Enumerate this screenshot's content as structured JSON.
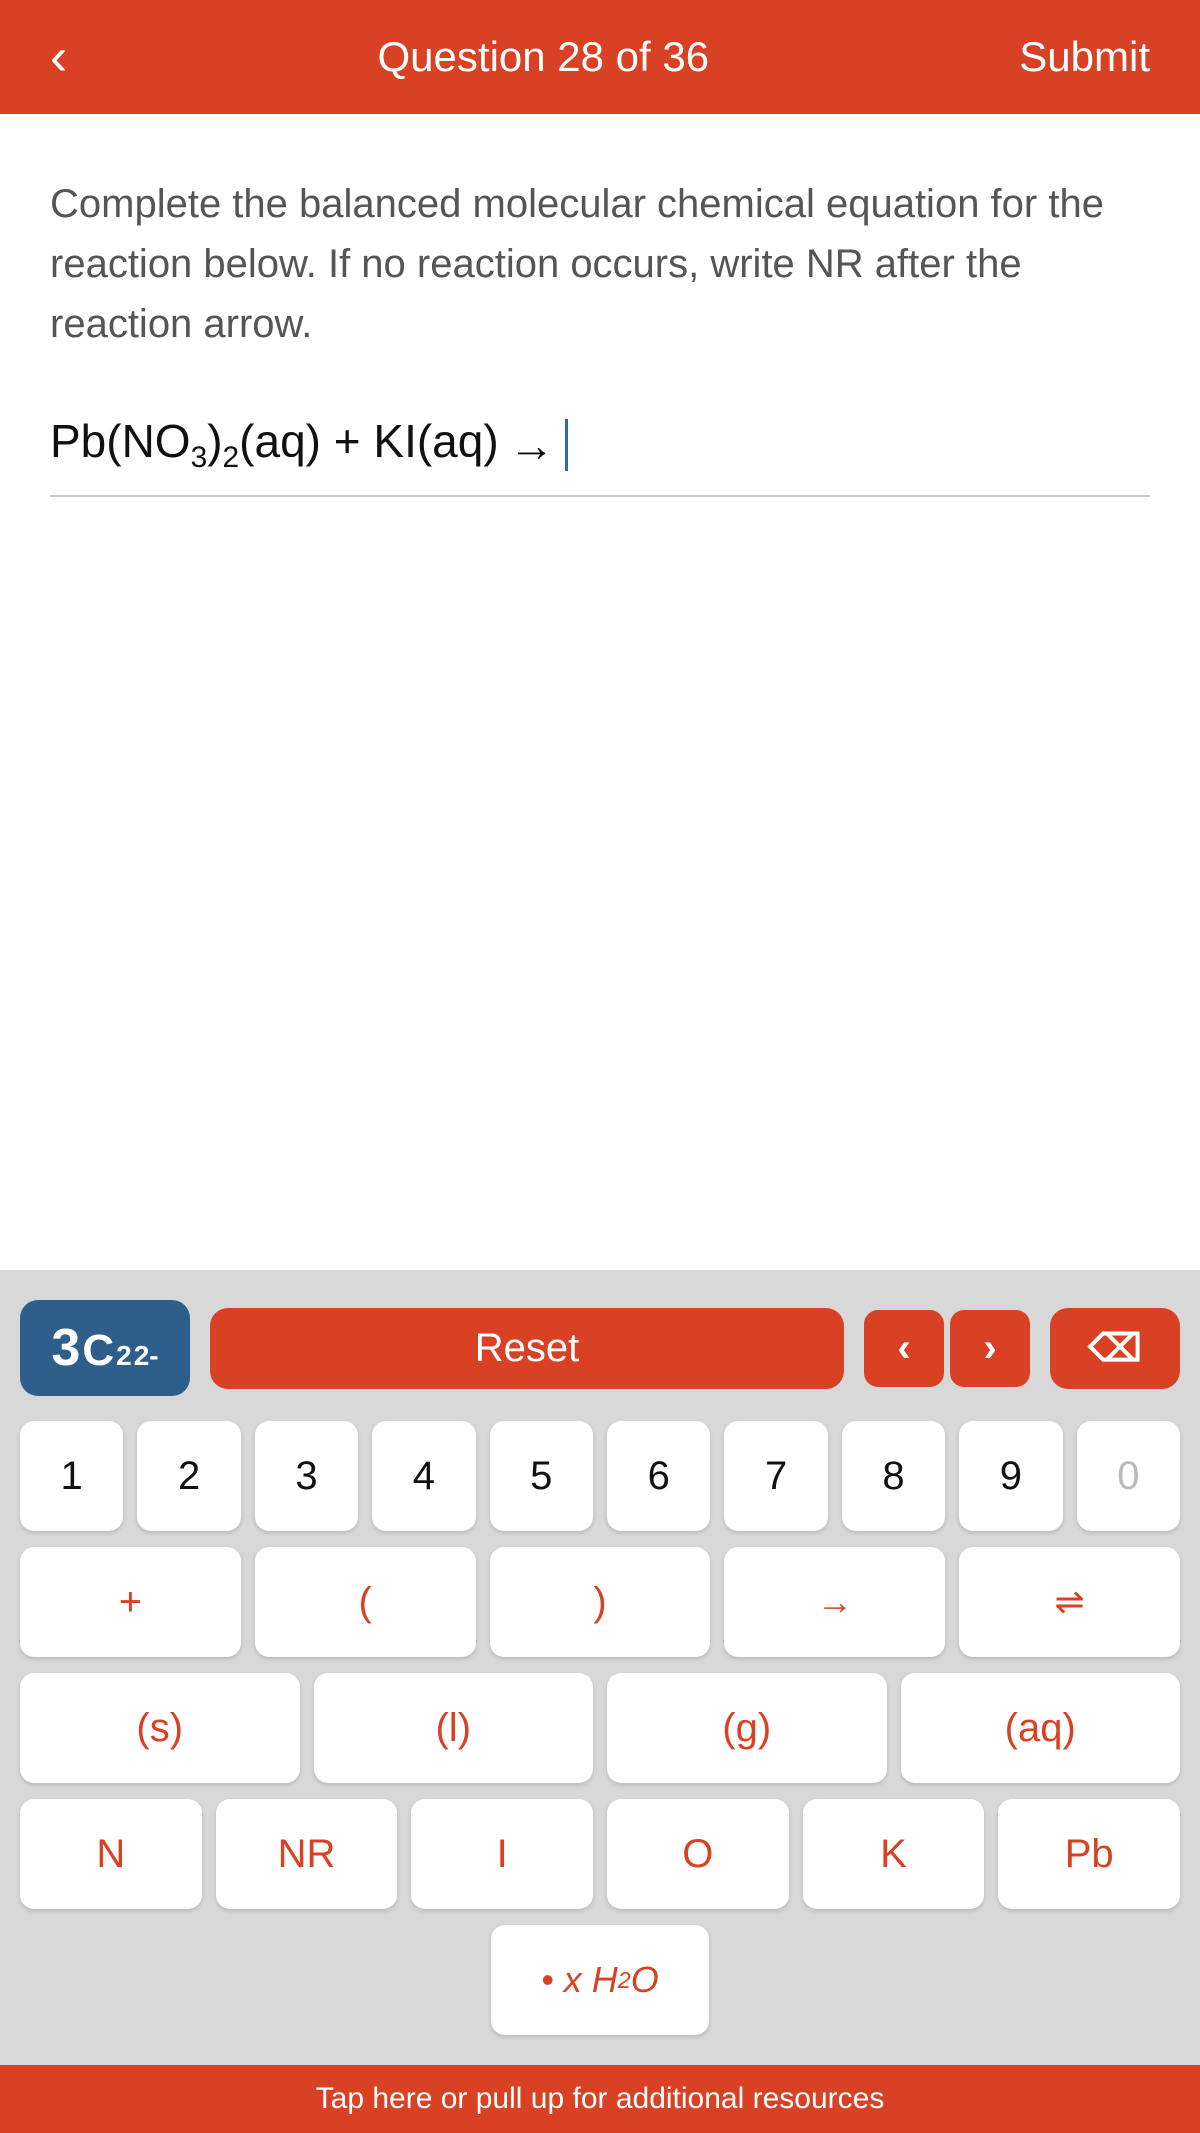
{
  "header": {
    "back_label": "‹",
    "title": "Question 28 of 36",
    "submit_label": "Submit"
  },
  "question": {
    "text": "Complete the balanced molecular chemical equation for the reaction below. If no reaction occurs, write NR after the reaction arrow."
  },
  "equation": {
    "left": "Pb(NO",
    "left_sub1": "3",
    "left_close": ")",
    "left_sub2": "2",
    "left_aq": "(aq) + KI(aq)",
    "arrow": "→"
  },
  "keyboard": {
    "coeff_label": "3C₂²⁻",
    "reset_label": "Reset",
    "nav_left": "‹",
    "nav_right": "›",
    "numbers": [
      "1",
      "2",
      "3",
      "4",
      "5",
      "6",
      "7",
      "8",
      "9",
      "0"
    ],
    "symbols": [
      "+",
      "(",
      ")",
      "→",
      "⇌"
    ],
    "states": [
      "(s)",
      "(l)",
      "(g)",
      "(aq)"
    ],
    "elements": [
      "N",
      "NR",
      "I",
      "O",
      "K",
      "Pb"
    ],
    "water_label": "• x H₂O"
  },
  "footer": {
    "text": "Tap here or pull up for additional resources"
  }
}
